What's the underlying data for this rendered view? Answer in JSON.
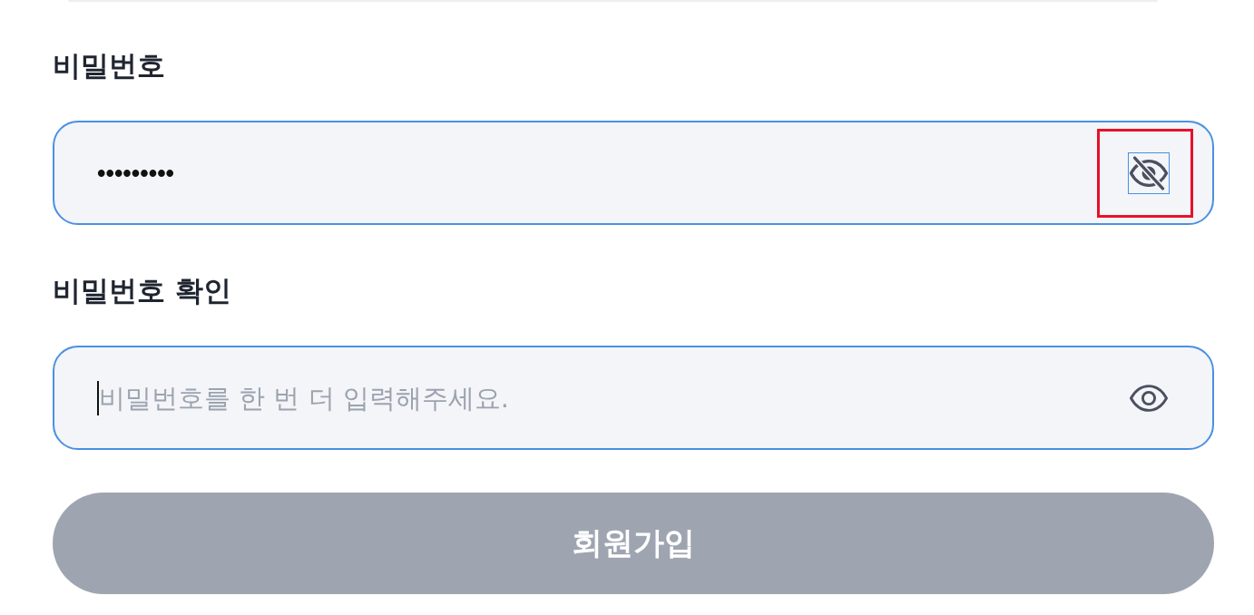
{
  "form": {
    "fields": [
      {
        "label": "비밀번호",
        "value": "•••••••••",
        "masked": true,
        "focused": false,
        "toggle": {
          "focused": true,
          "highlighted": true
        }
      },
      {
        "label": "비밀번호 확인",
        "placeholder": "비밀번호를 한 번 더 입력해주세요.",
        "masked": false,
        "focused": true,
        "toggle": {
          "focused": false,
          "highlighted": false
        }
      }
    ],
    "submit": {
      "label": "회원가입",
      "disabled": true
    }
  }
}
